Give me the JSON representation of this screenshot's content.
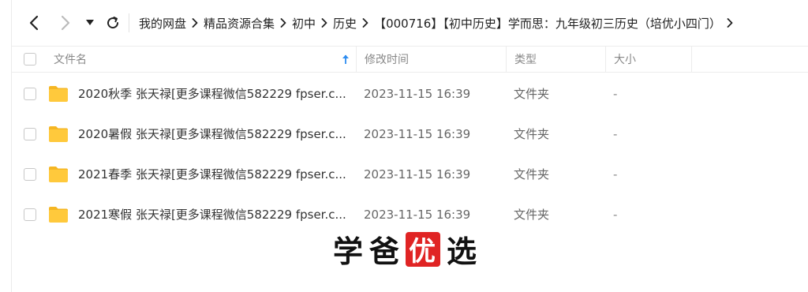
{
  "toolbar": {
    "back_icon": "chevron-left-icon",
    "forward_icon": "chevron-right-icon",
    "dropdown_icon": "caret-down-icon",
    "refresh_icon": "refresh-icon",
    "breadcrumbs": [
      "我的网盘",
      "精品资源合集",
      "初中",
      "历史",
      "【000716】【初中历史】学而思：九年级初三历史（培优小四门）"
    ],
    "separator_icon": "chevron-right-icon"
  },
  "table": {
    "headers": {
      "name": "文件名",
      "mtime": "修改时间",
      "type": "类型",
      "size": "大小"
    },
    "sort_icon": "arrow-up-icon",
    "rows": [
      {
        "name": "2020秋季 张天禄[更多课程微信582229 fpser.c...",
        "mtime": "2023-11-15 16:39",
        "type": "文件夹",
        "size": "-"
      },
      {
        "name": "2020暑假 张天禄[更多课程微信582229 fpser.c...",
        "mtime": "2023-11-15 16:39",
        "type": "文件夹",
        "size": "-"
      },
      {
        "name": "2021春季 张天禄[更多课程微信582229 fpser.c...",
        "mtime": "2023-11-15 16:39",
        "type": "文件夹",
        "size": "-"
      },
      {
        "name": "2021寒假 张天禄[更多课程微信582229 fpser.c...",
        "mtime": "2023-11-15 16:39",
        "type": "文件夹",
        "size": "-"
      }
    ]
  },
  "watermark": {
    "chars": [
      "学",
      "爸",
      "优",
      "选"
    ]
  },
  "colors": {
    "folder": "#FFC93C",
    "folder_tab": "#F5B623",
    "sort_arrow": "#2d8cf0",
    "watermark_accent": "#e02424"
  }
}
